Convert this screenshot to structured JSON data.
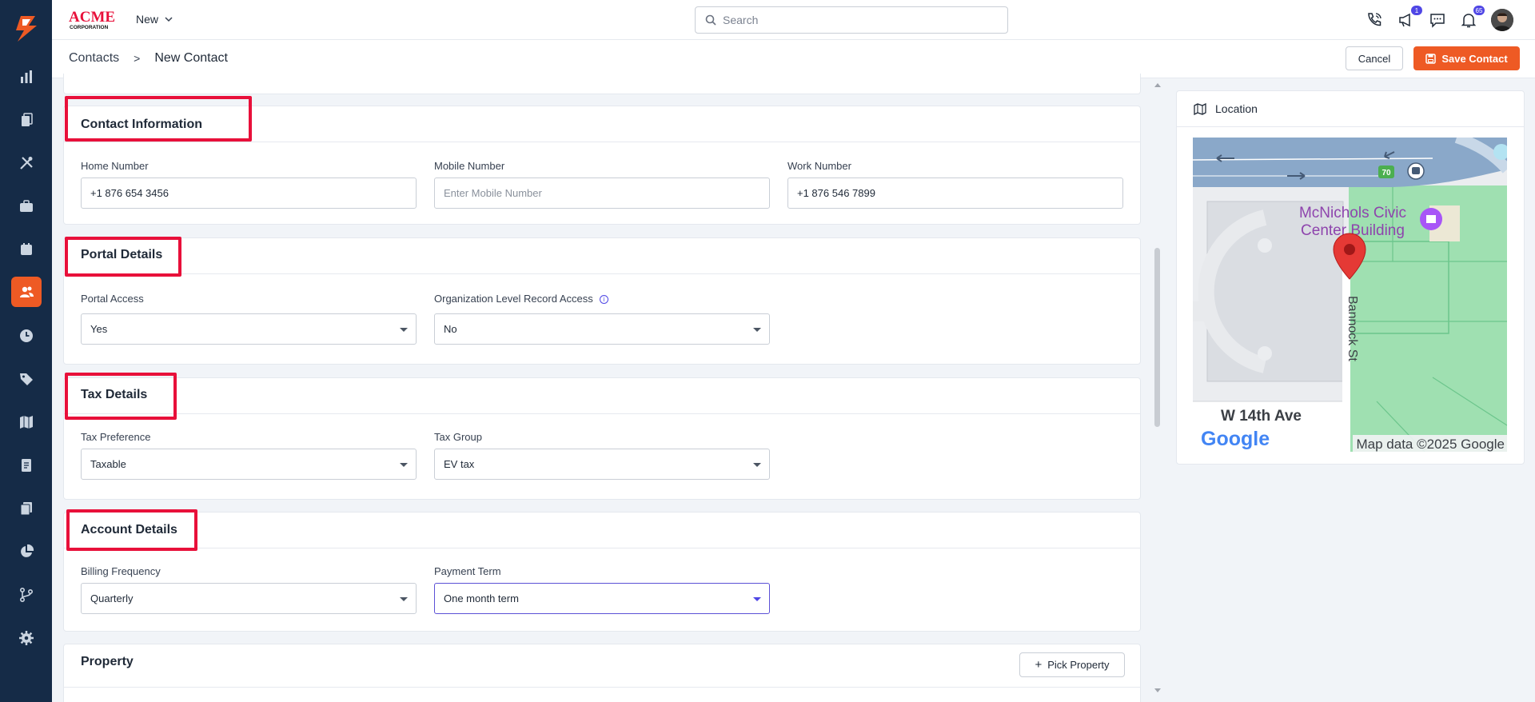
{
  "app": {
    "logo_text": "ACME",
    "logo_sub": "CORPORATION",
    "new_label": "New"
  },
  "search": {
    "placeholder": "Search"
  },
  "header": {
    "notif_badge_1": "1",
    "notif_badge_2": "65"
  },
  "breadcrumb": {
    "parent": "Contacts",
    "separator": ">",
    "current": "New Contact"
  },
  "actions": {
    "cancel": "Cancel",
    "save": "Save Contact"
  },
  "sections": {
    "contact_info": {
      "title": "Contact Information",
      "home_label": "Home Number",
      "home_value": "+1 876 654 3456",
      "mobile_label": "Mobile Number",
      "mobile_placeholder": "Enter Mobile Number",
      "work_label": "Work Number",
      "work_value": "+1 876 546 7899"
    },
    "portal": {
      "title": "Portal Details",
      "access_label": "Portal Access",
      "access_value": "Yes",
      "org_label": "Organization Level Record Access",
      "org_value": "No"
    },
    "tax": {
      "title": "Tax Details",
      "pref_label": "Tax Preference",
      "pref_value": "Taxable",
      "group_label": "Tax Group",
      "group_value": "EV tax"
    },
    "account": {
      "title": "Account Details",
      "billing_label": "Billing Frequency",
      "billing_value": "Quarterly",
      "payment_label": "Payment Term",
      "payment_value": "One month term"
    },
    "property": {
      "title": "Property",
      "pick_label": "Pick Property"
    }
  },
  "location": {
    "title": "Location",
    "map": {
      "place_line1": "McNichols Civic",
      "place_line2": "Center Building",
      "street": "Bannock St",
      "avenue": "W 14th Ave",
      "highway": "70",
      "attribution": "Map data ©2025 Google",
      "brand": "Google"
    }
  },
  "colors": {
    "brand": "#ee5a24",
    "sidebar": "#152b47",
    "highlight": "#e8103a",
    "focus": "#5b50d6"
  }
}
